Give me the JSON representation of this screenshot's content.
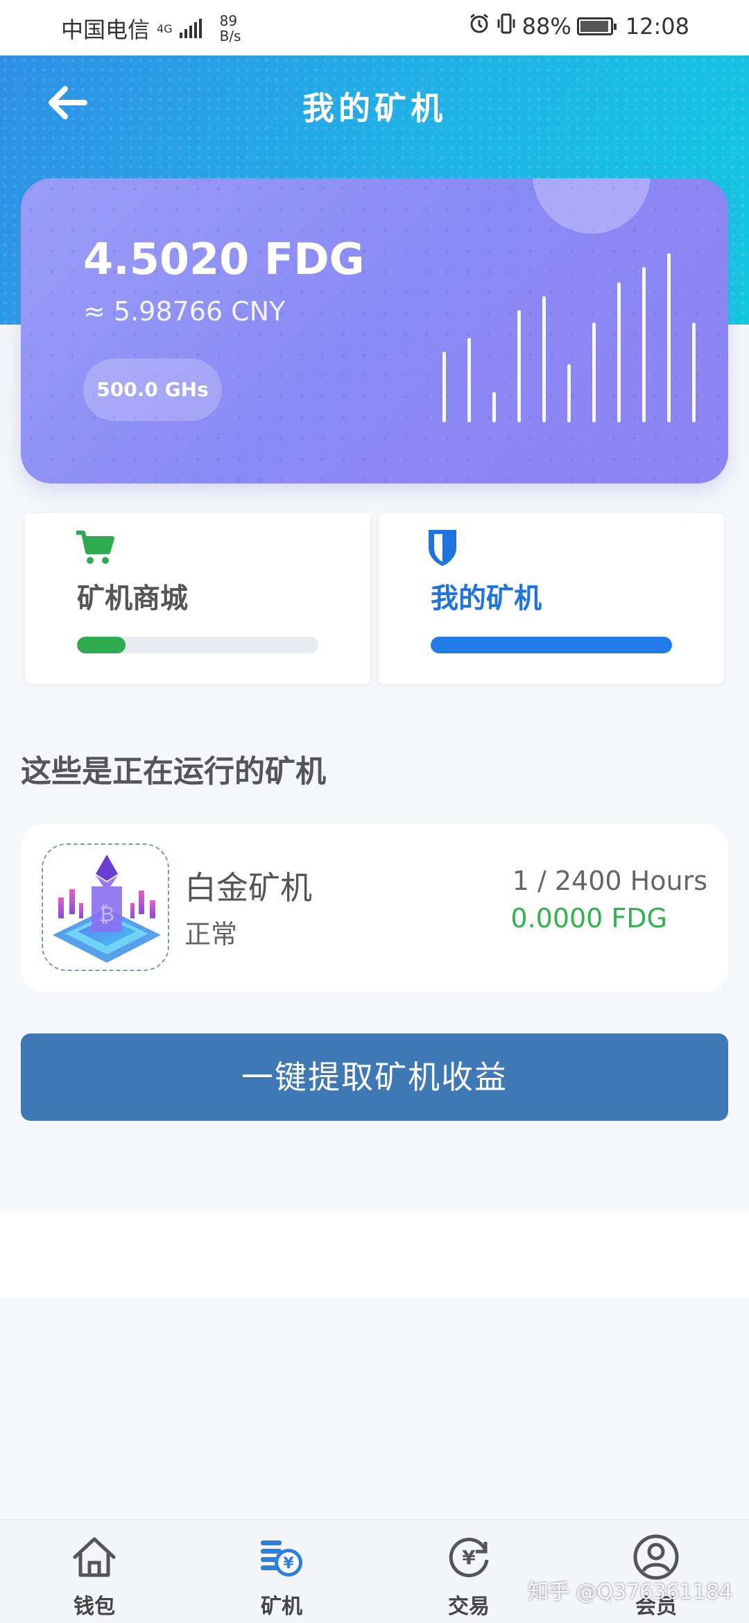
{
  "status_bar": {
    "carrier": "中国电信",
    "network": "4G",
    "speed_value": "89",
    "speed_unit": "B/s",
    "battery": "88%",
    "time": "12:08"
  },
  "header": {
    "title": "我的矿机"
  },
  "balance_card": {
    "amount": "4.5020 FDG",
    "cny": "≈ 5.98766 CNY",
    "hashrate": "500.0 GHs"
  },
  "tabs": [
    {
      "label": "矿机商城",
      "icon": "cart-icon",
      "progress": 0.2,
      "color": "#2eab4f"
    },
    {
      "label": "我的矿机",
      "icon": "shield-icon",
      "progress": 1.0,
      "color": "#1f7be8"
    }
  ],
  "section": {
    "title": "这些是正在运行的矿机"
  },
  "miner": {
    "name": "白金矿机",
    "status": "正常",
    "hours": "1 / 2400 Hours",
    "earnings": "0.0000 FDG"
  },
  "claim_button": {
    "label": "一键提取矿机收益"
  },
  "bottom_nav": [
    {
      "label": "钱包",
      "icon": "home-icon"
    },
    {
      "label": "矿机",
      "icon": "coins-icon"
    },
    {
      "label": "交易",
      "icon": "yen-exchange-icon"
    },
    {
      "label": "会员",
      "icon": "user-icon"
    }
  ],
  "watermark": "知乎 @Q376361184",
  "colors": {
    "header_gradient_start": "#2f8fe6",
    "header_gradient_end": "#12c9e0",
    "card_purple": "#8a8af5",
    "accent_blue": "#1f7be8",
    "accent_green": "#2eab4f",
    "button_blue": "#3e79b6"
  }
}
